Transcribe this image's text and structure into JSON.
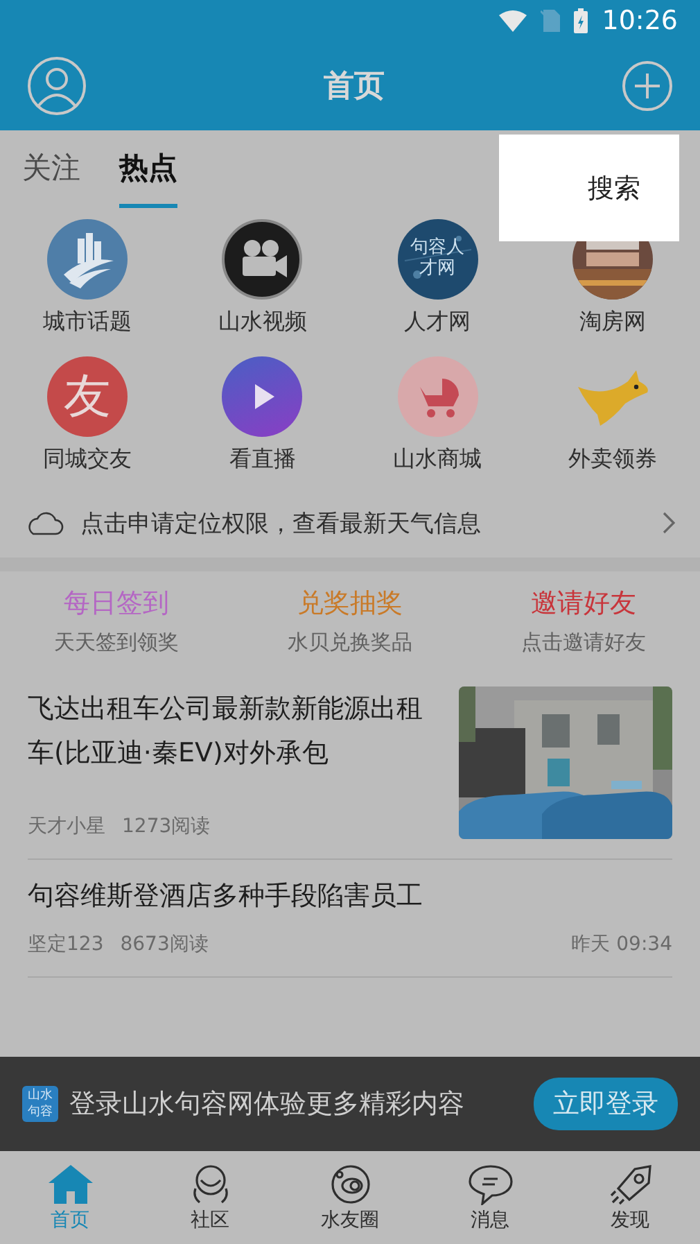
{
  "status_bar": {
    "time": "10:26"
  },
  "header": {
    "title": "首页"
  },
  "tabs": [
    {
      "label": "关注",
      "selected": false
    },
    {
      "label": "热点",
      "selected": true
    }
  ],
  "popup_menu": {
    "items": [
      "搜索"
    ]
  },
  "shortcuts": [
    {
      "kind": "city",
      "label": "城市话题"
    },
    {
      "kind": "video",
      "label": "山水视频"
    },
    {
      "kind": "talent",
      "label": "人才网",
      "glyph": "句容人才网"
    },
    {
      "kind": "house",
      "label": "淘房网"
    },
    {
      "kind": "friend",
      "label": "同城交友",
      "glyph": "友"
    },
    {
      "kind": "live",
      "label": "看直播"
    },
    {
      "kind": "shop",
      "label": "山水商城"
    },
    {
      "kind": "takeout",
      "label": "外卖领券"
    }
  ],
  "weather": {
    "text": "点击申请定位权限，查看最新天气信息"
  },
  "tasks": [
    {
      "title": "每日签到",
      "subtitle": "天天签到领奖",
      "color": "#b466c4"
    },
    {
      "title": "兑奖抽奖",
      "subtitle": "水贝兑换奖品",
      "color": "#c97a28"
    },
    {
      "title": "邀请好友",
      "subtitle": "点击邀请好友",
      "color": "#c8353b"
    }
  ],
  "articles": [
    {
      "kind": "picture",
      "title": "飞达出租车公司最新款新能源出租车(比亚迪·秦EV)对外承包",
      "author": "天才小星",
      "reads": "1273阅读"
    },
    {
      "kind": "text",
      "title": "句容维斯登酒店多种手段陷害员工",
      "author": "坚定123",
      "reads": "8673阅读",
      "time": "昨天 09:34"
    }
  ],
  "login_banner": {
    "logo": "山水句容",
    "text": "登录山水句容网体验更多精彩内容",
    "button": "立即登录"
  },
  "bottom_nav": [
    {
      "kind": "home",
      "label": "首页",
      "selected": true
    },
    {
      "kind": "community",
      "label": "社区",
      "selected": false
    },
    {
      "kind": "circle",
      "label": "水友圈",
      "selected": false
    },
    {
      "kind": "message",
      "label": "消息",
      "selected": false
    },
    {
      "kind": "discover",
      "label": "发现",
      "selected": false
    }
  ]
}
